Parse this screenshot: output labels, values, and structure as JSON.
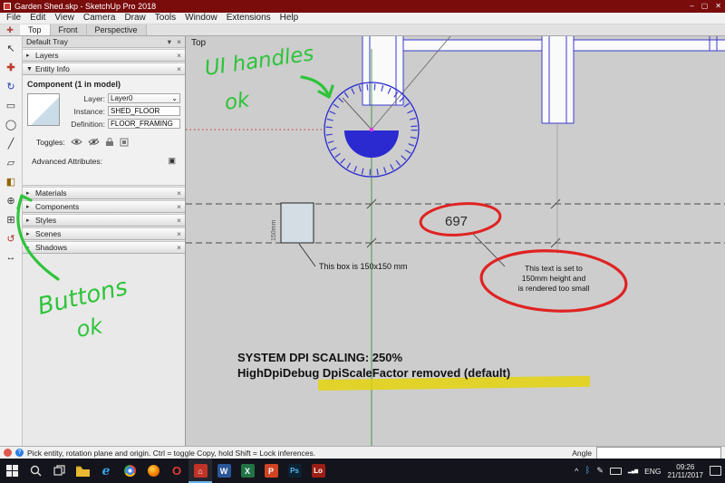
{
  "window": {
    "title": "Garden Shed.skp - SketchUp Pro 2018"
  },
  "icons": {
    "minimize": "–",
    "maximize": "▢",
    "close": "✕",
    "panel_close": "×",
    "collapsed": "▸",
    "expanded": "▼",
    "caret": "⌄",
    "pin": "▾",
    "handle": "✚",
    "adv": "▣",
    "tray_caret": "^",
    "help": "?"
  },
  "menubar": {
    "items": [
      "File",
      "Edit",
      "View",
      "Camera",
      "Draw",
      "Tools",
      "Window",
      "Extensions",
      "Help"
    ]
  },
  "scene_tabs": {
    "tabs": [
      "Top",
      "Front",
      "Perspective"
    ]
  },
  "tools": [
    {
      "name": "select",
      "glyph": "↖"
    },
    {
      "name": "move",
      "glyph": "✚"
    },
    {
      "name": "rotate",
      "glyph": "↻"
    },
    {
      "name": "rectangle",
      "glyph": "▭"
    },
    {
      "name": "circle",
      "glyph": "◯"
    },
    {
      "name": "line",
      "glyph": "╱"
    },
    {
      "name": "eraser",
      "glyph": "▱"
    },
    {
      "name": "paint",
      "glyph": "◧"
    },
    {
      "name": "zoom",
      "glyph": "⊕"
    },
    {
      "name": "zoom-extents",
      "glyph": "⊞"
    },
    {
      "name": "orbit",
      "glyph": "↺"
    },
    {
      "name": "pan",
      "glyph": "↔"
    }
  ],
  "tray": {
    "title": "Default Tray",
    "layers_label": "Layers",
    "entity_info": {
      "label": "Entity Info",
      "component": "Component (1 in model)",
      "layer_label": "Layer:",
      "layer_value": "Layer0",
      "instance_label": "Instance:",
      "instance_value": "SHED_FLOOR",
      "definition_label": "Definition:",
      "definition_value": "FLOOR_FRAMING",
      "toggles_label": "Toggles:"
    },
    "advanced_attributes_label": "Advanced Attributes:",
    "panels": [
      "Materials",
      "Components",
      "Styles",
      "Scenes",
      "Shadows"
    ]
  },
  "viewport": {
    "view_label": "Top",
    "dim_label": "150mm",
    "box_note": "This box is 150x150 mm",
    "big_number": "697",
    "note_line1": "This text is set to",
    "note_line2": "150mm height and",
    "note_line3": "is rendered too small",
    "dpi_line1": "SYSTEM DPI SCALING: 250%",
    "dpi_line2": "HighDpiDebug DpiScaleFactor removed (default)"
  },
  "annotations": {
    "ui_handles_1": "UI handles",
    "ui_handles_2": "ok",
    "buttons_1": "Buttons",
    "buttons_2": "ok",
    "green": "#2ec43a",
    "red": "#e02222",
    "yellow": "#e6d400"
  },
  "statusbar": {
    "message": "Pick entity, rotation plane and origin.  Ctrl = toggle Copy, hold Shift = Lock inferences.",
    "angle_label": "Angle"
  },
  "taskbar": {
    "icons": [
      {
        "name": "edge",
        "glyph": "e"
      },
      {
        "name": "opera",
        "glyph": "O"
      },
      {
        "name": "sketchup",
        "glyph": "⌂"
      },
      {
        "name": "word",
        "glyph": "W"
      },
      {
        "name": "excel",
        "glyph": "X"
      },
      {
        "name": "powerpoint",
        "glyph": "P"
      },
      {
        "name": "photoshop",
        "glyph": "Ps"
      },
      {
        "name": "layout",
        "glyph": "Lo"
      }
    ],
    "language": "ENG",
    "time": "09:26",
    "date": "21/11/2017"
  }
}
